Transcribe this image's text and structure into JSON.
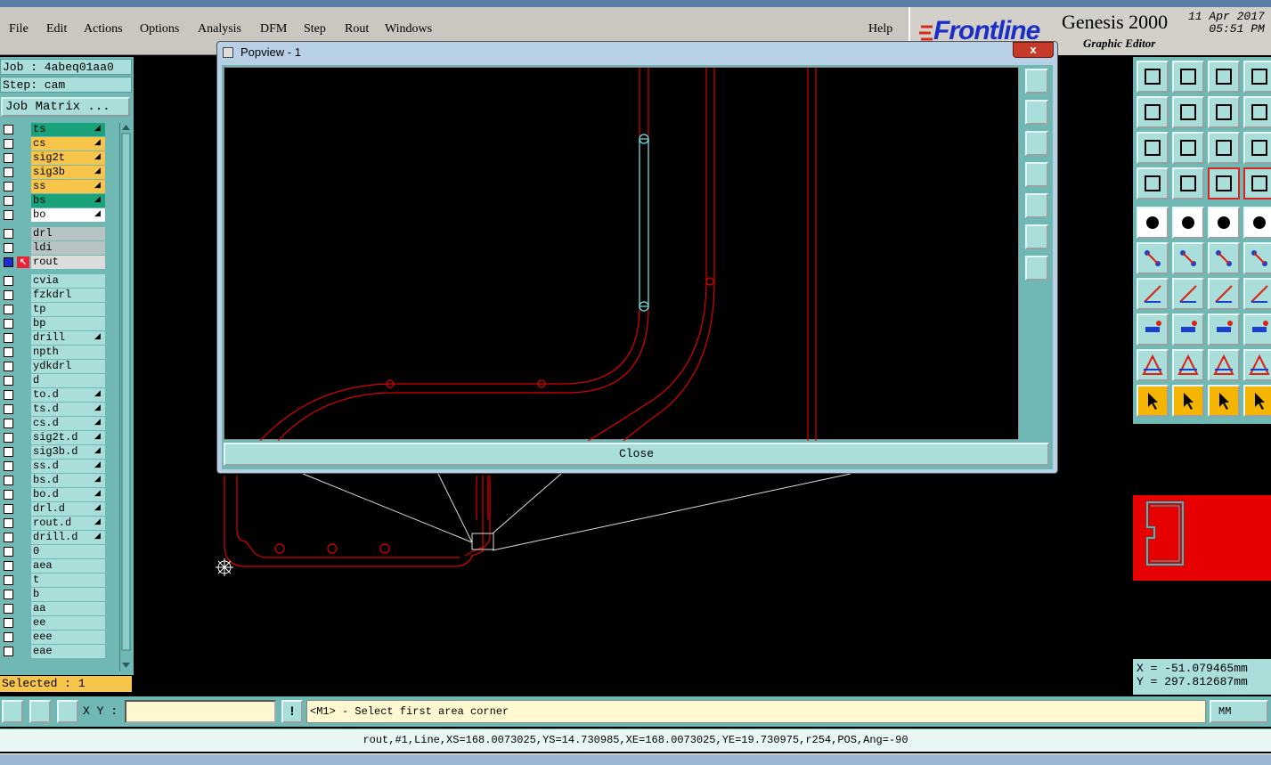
{
  "menu": {
    "items": [
      "File",
      "Edit",
      "Actions",
      "Options",
      "Analysis",
      "DFM",
      "Step",
      "Rout",
      "Windows"
    ],
    "help": "Help"
  },
  "brand": {
    "logo_text": "Frontline",
    "product": "Genesis 2000",
    "subtitle": "Graphic Editor",
    "date": "11 Apr 2017",
    "time": "05:51 PM"
  },
  "left": {
    "job": "Job : 4abeq01aa0",
    "step": "Step: cam",
    "job_matrix": "Job Matrix ...",
    "selected": "Selected : 1",
    "layers": [
      {
        "name": "ts",
        "color": "#1aa37a",
        "mark": true
      },
      {
        "name": "cs",
        "color": "#f7c54a",
        "mark": true
      },
      {
        "name": "sig2t",
        "color": "#f7c54a",
        "mark": true
      },
      {
        "name": "sig3b",
        "color": "#f7c54a",
        "mark": true
      },
      {
        "name": "ss",
        "color": "#f7c54a",
        "mark": true
      },
      {
        "name": "bs",
        "color": "#1aa37a",
        "mark": true
      },
      {
        "name": "bo",
        "color": "#ffffff",
        "mark": true
      },
      {
        "name": "drl",
        "color": "#b6c4c4",
        "mark": false
      },
      {
        "name": "ldi",
        "color": "#b6c4c4",
        "mark": false
      },
      {
        "name": "rout",
        "color": "#dcdcdc",
        "mark": false
      },
      {
        "name": "cvia",
        "color": "#a9dedb",
        "mark": false
      },
      {
        "name": "fzkdrl",
        "color": "#a9dedb",
        "mark": false
      },
      {
        "name": "tp",
        "color": "#a9dedb",
        "mark": false
      },
      {
        "name": "bp",
        "color": "#a9dedb",
        "mark": false
      },
      {
        "name": "drill",
        "color": "#a9dedb",
        "mark": true
      },
      {
        "name": "npth",
        "color": "#a9dedb",
        "mark": false
      },
      {
        "name": "ydkdrl",
        "color": "#a9dedb",
        "mark": false
      },
      {
        "name": "d",
        "color": "#a9dedb",
        "mark": false
      },
      {
        "name": "to.d",
        "color": "#a9dedb",
        "mark": true
      },
      {
        "name": "ts.d",
        "color": "#a9dedb",
        "mark": true
      },
      {
        "name": "cs.d",
        "color": "#a9dedb",
        "mark": true
      },
      {
        "name": "sig2t.d",
        "color": "#a9dedb",
        "mark": true
      },
      {
        "name": "sig3b.d",
        "color": "#a9dedb",
        "mark": true
      },
      {
        "name": "ss.d",
        "color": "#a9dedb",
        "mark": true
      },
      {
        "name": "bs.d",
        "color": "#a9dedb",
        "mark": true
      },
      {
        "name": "bo.d",
        "color": "#a9dedb",
        "mark": true
      },
      {
        "name": "drl.d",
        "color": "#a9dedb",
        "mark": true
      },
      {
        "name": "rout.d",
        "color": "#a9dedb",
        "mark": true
      },
      {
        "name": "drill.d",
        "color": "#a9dedb",
        "mark": true
      },
      {
        "name": "0",
        "color": "#a9dedb",
        "mark": false
      },
      {
        "name": "aea",
        "color": "#a9dedb",
        "mark": false
      },
      {
        "name": "t",
        "color": "#a9dedb",
        "mark": false
      },
      {
        "name": "b",
        "color": "#a9dedb",
        "mark": false
      },
      {
        "name": "aa",
        "color": "#a9dedb",
        "mark": false
      },
      {
        "name": "ee",
        "color": "#a9dedb",
        "mark": false
      },
      {
        "name": "eee",
        "color": "#a9dedb",
        "mark": false
      },
      {
        "name": "eae",
        "color": "#a9dedb",
        "mark": false
      }
    ]
  },
  "popview": {
    "title": "Popview - 1",
    "close_x": "x",
    "close_button": "Close"
  },
  "coords": {
    "x": "X = -51.079465mm",
    "y": "Y = 297.812687mm"
  },
  "bottom": {
    "xy_label": "X Y :",
    "xy_value": "",
    "prompt": "<M1> - Select first area corner",
    "units": "MM",
    "info": "rout,#1,Line,XS=168.0073025,YS=14.730985,XE=168.0073025,YE=19.730975,r254,POS,Ang=-90"
  },
  "icons": {
    "toolbar": [
      "zoom-home-icon",
      "zoom-in-area-icon",
      "home-icon",
      "window-icon",
      "pan-left-icon",
      "pan-right-icon",
      "undo-icon",
      "redo-icon",
      "fit-icon",
      "center-icon",
      "ratio-icon",
      "help-icon",
      "measure-icon",
      "snap-icon",
      "layer-select-icon",
      "layer-select2-icon",
      "pad-add-icon",
      "surface-icon",
      "ruler-icon",
      "dot-icon",
      "node-icon",
      "cross-icon",
      "line-node-icon",
      "line-node2-icon",
      "line-add-icon",
      "line-blue-icon",
      "arc-icon",
      "fill-icon",
      "box-icon",
      "minus-icon",
      "bracket-icon",
      "grid-icon",
      "tri1-icon",
      "tri2-icon",
      "tri3-icon",
      "tri4-icon",
      "pointer-icon",
      "pointer2-icon",
      "pointer3-icon",
      "pointer4-icon"
    ]
  }
}
